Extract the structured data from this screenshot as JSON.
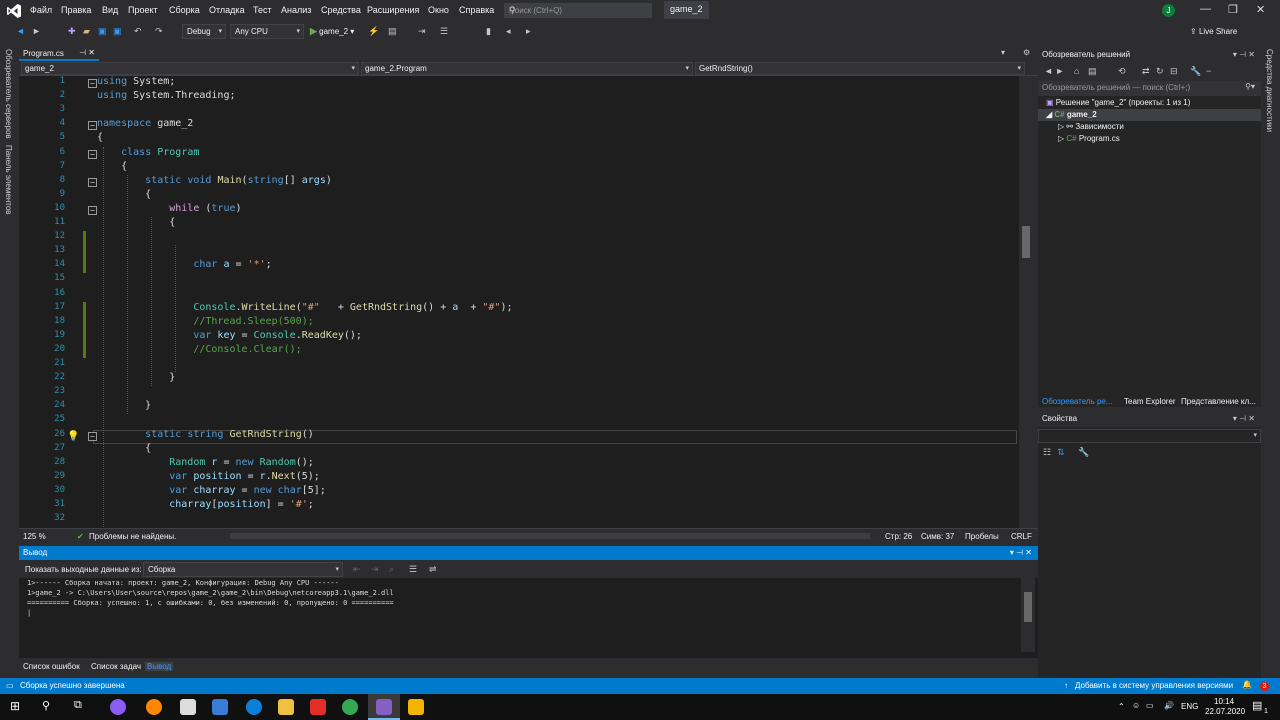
{
  "menubar": {
    "items": [
      "Файл",
      "Правка",
      "Вид",
      "Проект",
      "Сборка",
      "Отладка",
      "Тест",
      "Анализ",
      "Средства",
      "Расширения",
      "Окно",
      "Справка"
    ],
    "search_placeholder": "Поиск (Ctrl+Q)",
    "solution_name": "game_2",
    "user_initial": "J"
  },
  "toolbar": {
    "config": "Debug",
    "platform": "Any CPU",
    "run_label": "game_2",
    "liveshare": "Live Share"
  },
  "side_left": {
    "server_explorer": "Обозреватель серверов",
    "toolbox": "Панель элементов"
  },
  "side_right": {
    "diagnostics": "Средства диагностики"
  },
  "editor": {
    "tab_name": "Program.cs",
    "nav_project": "game_2",
    "nav_class": "game_2.Program",
    "nav_member": "GetRndString()",
    "lines": [
      {
        "n": "1",
        "html": "<span class='kw'>using</span> System;"
      },
      {
        "n": "2",
        "html": "<span class='kw'>using</span> System.Threading;"
      },
      {
        "n": "3",
        "html": ""
      },
      {
        "n": "4",
        "html": "<span class='kw'>namespace</span> game_2"
      },
      {
        "n": "5",
        "html": "{"
      },
      {
        "n": "6",
        "html": "    <span class='kw'>class</span> <span class='ty'>Program</span>"
      },
      {
        "n": "7",
        "html": "    {"
      },
      {
        "n": "8",
        "html": "        <span class='kw'>static</span> <span class='kw'>void</span> <span class='fn'>Main</span>(<span class='kw'>string</span>[] <span class='pa'>args</span>)"
      },
      {
        "n": "9",
        "html": "        {"
      },
      {
        "n": "10",
        "html": "            <span class='ctl'>while</span> (<span class='kw'>true</span>)"
      },
      {
        "n": "11",
        "html": "            {"
      },
      {
        "n": "12",
        "html": ""
      },
      {
        "n": "13",
        "html": ""
      },
      {
        "n": "14",
        "html": "                <span class='kw'>char</span> <span class='pa'>a</span> = <span class='st'>'*'</span>;"
      },
      {
        "n": "15",
        "html": ""
      },
      {
        "n": "16",
        "html": ""
      },
      {
        "n": "17",
        "html": "                <span class='ty'>Console</span>.<span class='fn'>WriteLine</span>(<span class='st'>\"#\"</span>   + <span class='fn'>GetRndString</span>() + <span class='pa'>a</span>  + <span class='st'>\"#\"</span>);"
      },
      {
        "n": "18",
        "html": "                <span class='cm'>//Thread.Sleep(500);</span>"
      },
      {
        "n": "19",
        "html": "                <span class='kw'>var</span> <span class='pa'>key</span> = <span class='ty'>Console</span>.<span class='fn'>ReadKey</span>();"
      },
      {
        "n": "20",
        "html": "                <span class='cm'>//Console.Clear();</span>"
      },
      {
        "n": "21",
        "html": ""
      },
      {
        "n": "22",
        "html": "            }"
      },
      {
        "n": "23",
        "html": ""
      },
      {
        "n": "24",
        "html": "        }"
      },
      {
        "n": "25",
        "html": ""
      },
      {
        "n": "26",
        "html": "        <span class='kw'>static</span> <span class='kw'>string</span> <span class='fn'>GetRndString</span>()"
      },
      {
        "n": "27",
        "html": "        {"
      },
      {
        "n": "28",
        "html": "            <span class='ty'>Random</span> <span class='pa'>r</span> = <span class='kw'>new</span> <span class='ty'>Random</span>();"
      },
      {
        "n": "29",
        "html": "            <span class='kw'>var</span> <span class='pa'>position</span> = <span class='pa'>r</span>.<span class='fn'>Next</span>(5);"
      },
      {
        "n": "30",
        "html": "            <span class='kw'>var</span> <span class='pa'>charray</span> = <span class='kw'>new</span> <span class='kw'>char</span>[5];"
      },
      {
        "n": "31",
        "html": "            <span class='pa'>charray</span>[<span class='pa'>position</span>] = <span class='st'>'#'</span>;"
      },
      {
        "n": "32",
        "html": ""
      }
    ]
  },
  "editor_status": {
    "zoom": "125 %",
    "issues": "Проблемы не найдены.",
    "line": "Стр: 26",
    "col": "Симв: 37",
    "spaces": "Пробелы",
    "eol": "CRLF"
  },
  "solution_explorer": {
    "title": "Обозреватель решений",
    "search_placeholder": "Обозреватель решений — поиск (Ctrl+;)",
    "solution_node": "Решение \"game_2\" (проекты: 1 из 1)",
    "project_node": "game_2",
    "deps_node": "Зависимости",
    "file_node": "Program.cs",
    "tabs": [
      "Обозреватель ре...",
      "Team Explorer",
      "Представление кл..."
    ]
  },
  "properties": {
    "title": "Свойства"
  },
  "output": {
    "title": "Вывод",
    "show_from_label": "Показать выходные данные из:",
    "source": "Сборка",
    "lines": [
      "1>------ Сборка начата: проект: game_2, Конфигурация: Debug Any CPU ------",
      "1>game_2 -> C:\\Users\\User\\source\\repos\\game_2\\game_2\\bin\\Debug\\netcoreapp3.1\\game_2.dll",
      "========== Сборка: успешно: 1, с ошибками: 0, без изменений: 0, пропущено: 0 =========="
    ]
  },
  "bottom_tabs": [
    "Список ошибок",
    "Список задач",
    "Вывод"
  ],
  "statusbar": {
    "message": "Сборка успешно завершена",
    "source_control": "Добавить в систему управления версиями",
    "badge": "3"
  },
  "taskbar": {
    "language": "ENG",
    "time": "10:14",
    "date": "22.07.2020",
    "notif_count": "1"
  }
}
